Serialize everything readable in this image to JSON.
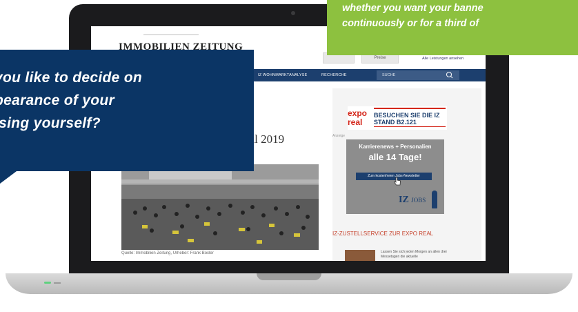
{
  "website": {
    "logo": "IMMOBILIEN ZEITUNG",
    "header_link": "Alle Leistungen ansehen",
    "header_tab_2": "Preise",
    "nav": {
      "wohnmarktanalyse": "IZ WOHNMARKTANALYSE",
      "recherche": "RECHERCHE",
      "search_placeholder": "SUCHE"
    },
    "article": {
      "title_visible": "eal 2019",
      "caption": "Quelle: Immobilien Zeitung, Urheber: Frank Boxler"
    },
    "sidebar": {
      "expo_logo_line1": "expo",
      "expo_logo_line2": "real",
      "expo_text_line1": "BESUCHEN SIE DIE IZ",
      "expo_text_line2": "STAND B2.121",
      "small_label": "Anzeige",
      "jobs_ad": {
        "line1": "Karrierenews + Personalien",
        "line2": "alle 14 Tage!",
        "button": "Zum kostenfreien Jobs-Newsletter",
        "logo_main": "IZ",
        "logo_sub": "JOBS"
      },
      "zustellservice_title": "IZ-ZUSTELLSERVICE ZUR EXPO REAL",
      "zustellservice_text": "Lassen Sie sich jeden Morgen an allen drei Messetagen die aktuelle"
    }
  },
  "callouts": {
    "blue_line1": "you like to decide on",
    "blue_line2": "pearance of your",
    "blue_line3": "ising yourself?",
    "green_line1": "whether you want your banne",
    "green_line2": "continuously or for a third of"
  },
  "colors": {
    "navy": "#0b3565",
    "nav_bar": "#1c3f6e",
    "green": "#8dc13f",
    "expo_red": "#d4261a"
  }
}
